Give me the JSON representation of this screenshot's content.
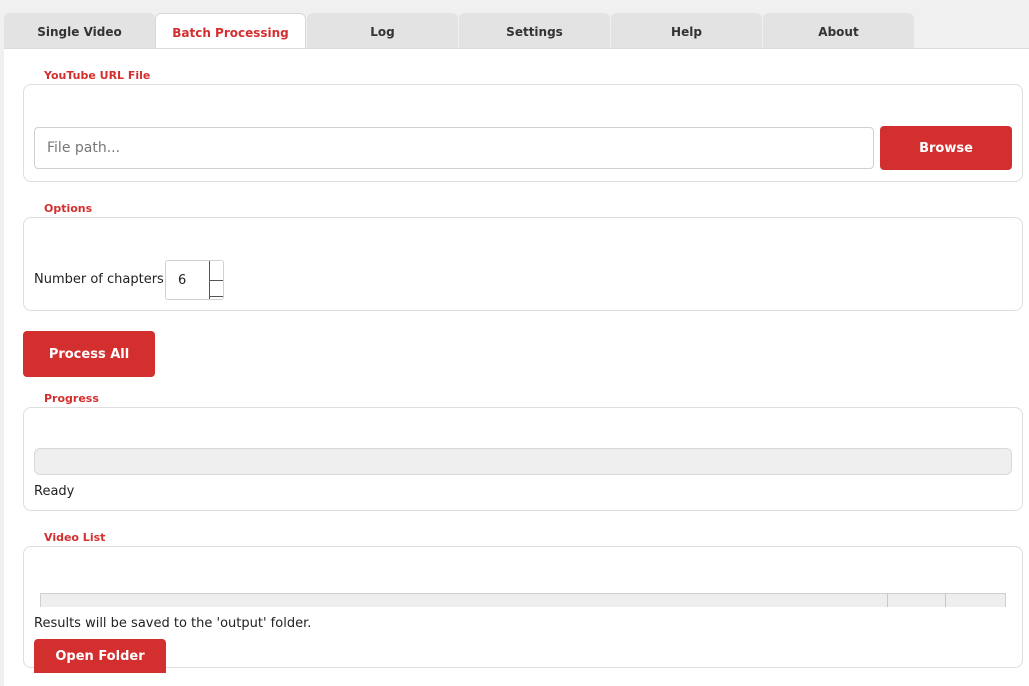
{
  "tabs": [
    {
      "label": "Single Video"
    },
    {
      "label": "Batch Processing"
    },
    {
      "label": "Log"
    },
    {
      "label": "Settings"
    },
    {
      "label": "Help"
    },
    {
      "label": "About"
    }
  ],
  "active_tab": "Batch Processing",
  "url_file": {
    "title": "YouTube URL File",
    "placeholder": "File path...",
    "value": "",
    "browse_label": "Browse"
  },
  "options": {
    "title": "Options",
    "chapters_label": "Number of chapters:",
    "chapters_value": "6"
  },
  "process_all_label": "Process All",
  "progress": {
    "title": "Progress",
    "value_percent": 0,
    "status": "Ready"
  },
  "video_list": {
    "title": "Video List",
    "columns": [],
    "rows": [],
    "note": "Results will be saved to the 'output' folder.",
    "open_folder_label": "Open Folder"
  },
  "colors": {
    "accent": "#d32f2f",
    "tab_bg": "#e3e3e3",
    "panel_bg": "#ffffff"
  }
}
